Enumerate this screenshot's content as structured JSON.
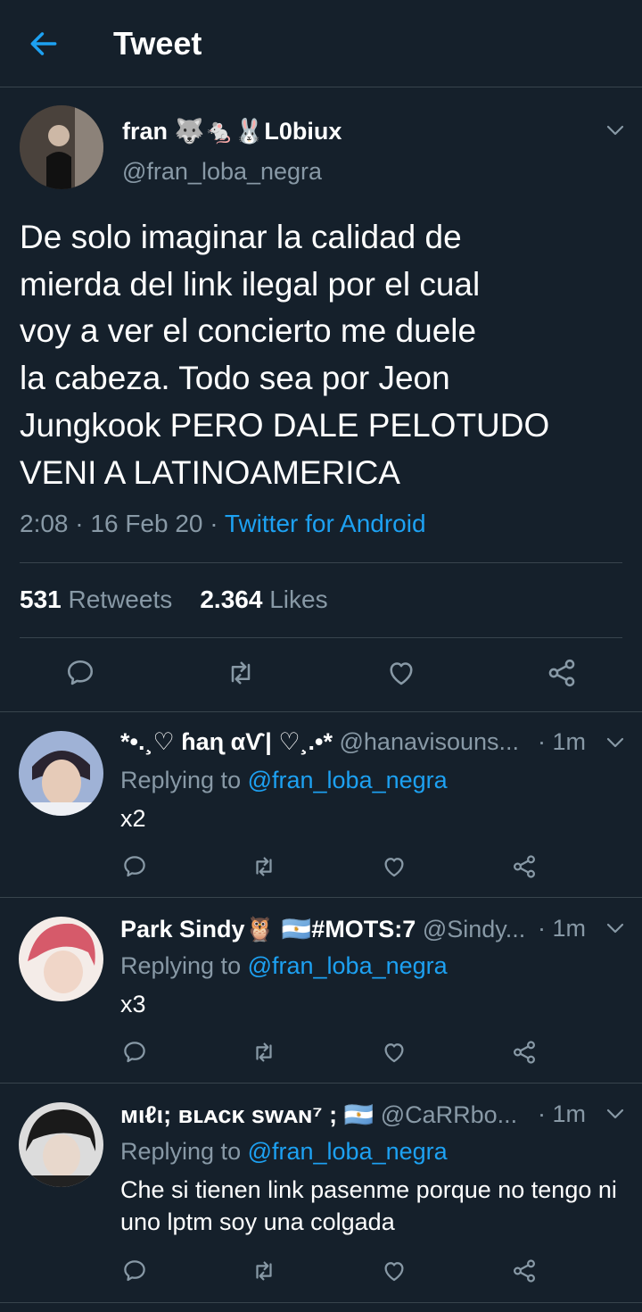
{
  "header": {
    "title": "Tweet"
  },
  "tweet": {
    "author_name": "fran 🐺🐁🐰L0biux",
    "author_handle": "@fran_loba_negra",
    "text": "De solo imaginar la calidad de\nmierda del link ilegal por el cual\nvoy a ver el concierto me duele\nla cabeza. Todo sea por Jeon\nJungkook PERO DALE PELOTUDO\nVENI A LATINOAMERICA",
    "time": "2:08",
    "date": "16 Feb 20",
    "source": "Twitter for Android",
    "retweets_count": "531",
    "retweets_label": "Retweets",
    "likes_count": "2.364",
    "likes_label": "Likes"
  },
  "replies": [
    {
      "name": "*•.¸♡ ɦaɳ αѴ| ♡¸.•*",
      "handle": "@hanavisouns...",
      "time": "1m",
      "replying_prefix": "Replying to ",
      "replying_to": "@fran_loba_negra",
      "text": "x2"
    },
    {
      "name": "Park Sindy🦉 🇦🇷#MOTS:7",
      "handle": "@Sindy...",
      "time": "1m",
      "replying_prefix": "Replying to ",
      "replying_to": "@fran_loba_negra",
      "text": "x3"
    },
    {
      "name": "мιℓι; ʙʟᴀᴄᴋ sᴡᴀɴ⁷ ; 🇦🇷",
      "handle": "@CaRRbo...",
      "time": "1m",
      "replying_prefix": "Replying to ",
      "replying_to": "@fran_loba_negra",
      "text": "Che si tienen link pasenme porque no tengo ni uno lptm soy una colgada"
    }
  ],
  "colors": {
    "background": "#15202b",
    "accent": "#1da1f2",
    "secondary_text": "#8899a6",
    "divider": "#38444d"
  }
}
